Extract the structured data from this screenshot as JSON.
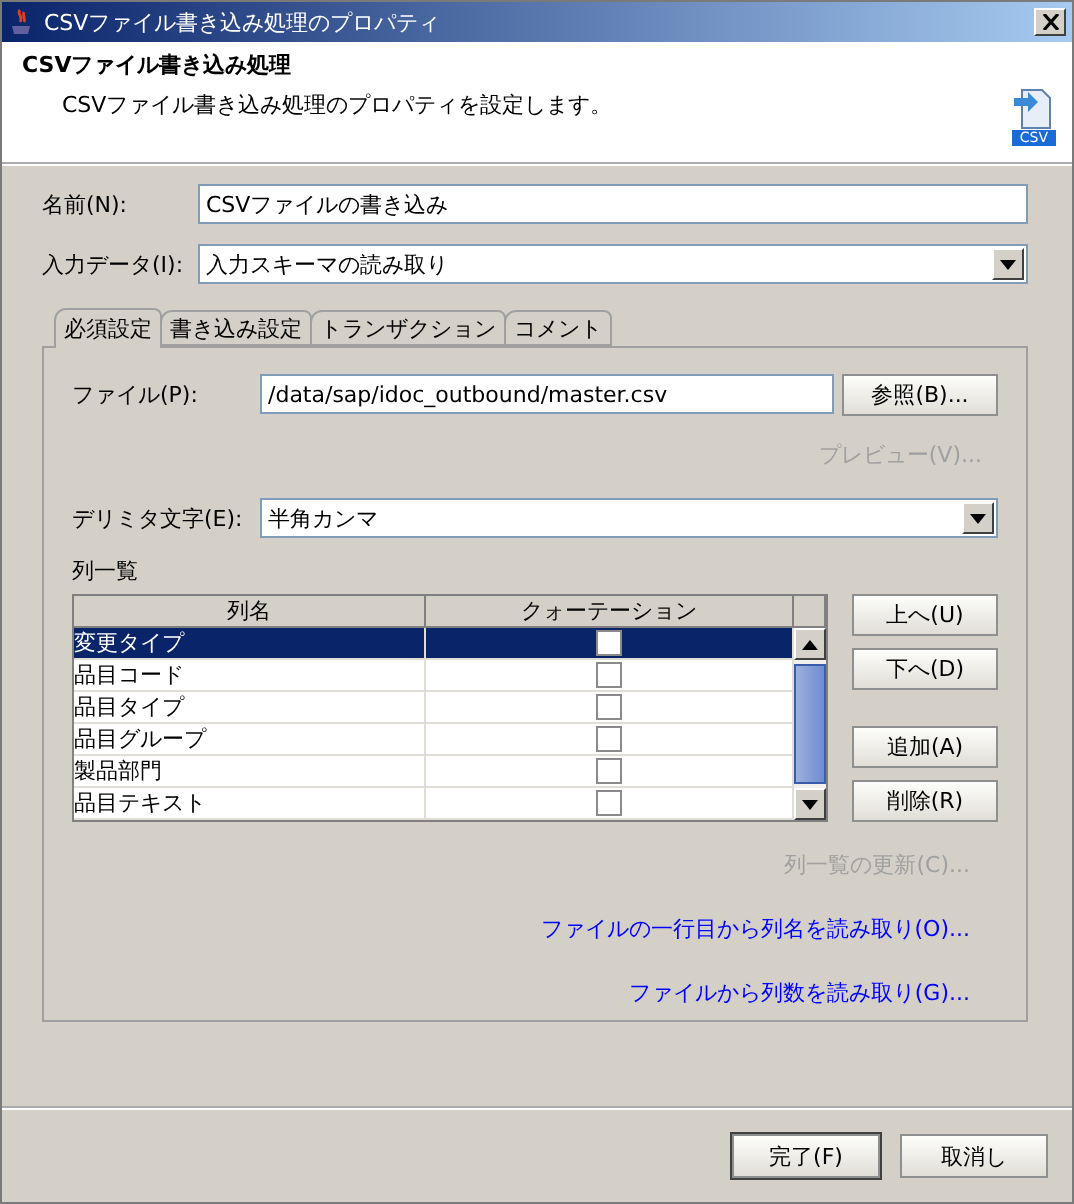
{
  "window": {
    "title": "CSVファイル書き込み処理のプロパティ"
  },
  "header": {
    "title": "CSVファイル書き込み処理",
    "description": "CSVファイル書き込み処理のプロパティを設定します。",
    "icon_label": "CSV"
  },
  "name_field": {
    "label": "名前(N):",
    "value": "CSVファイルの書き込み"
  },
  "input_data": {
    "label": "入力データ(I):",
    "value": "入力スキーマの読み取り"
  },
  "tabs": [
    {
      "label": "必須設定",
      "selected": true
    },
    {
      "label": "書き込み設定",
      "selected": false
    },
    {
      "label": "トランザクション",
      "selected": false
    },
    {
      "label": "コメント",
      "selected": false
    }
  ],
  "file_field": {
    "label": "ファイル(P):",
    "value": "/data/sap/idoc_outbound/master.csv",
    "browse_button": "参照(B)..."
  },
  "preview_button": {
    "label": "プレビュー(V)...",
    "disabled": true
  },
  "delimiter": {
    "label": "デリミタ文字(E):",
    "value": "半角カンマ"
  },
  "column_list": {
    "title": "列一覧",
    "columns": [
      "列名",
      "クォーテーション"
    ],
    "rows": [
      {
        "name": "変更タイプ",
        "quoted": false,
        "selected": true
      },
      {
        "name": "品目コード",
        "quoted": false,
        "selected": false
      },
      {
        "name": "品目タイプ",
        "quoted": false,
        "selected": false
      },
      {
        "name": "品目グループ",
        "quoted": false,
        "selected": false
      },
      {
        "name": "製品部門",
        "quoted": false,
        "selected": false
      },
      {
        "name": "品目テキスト",
        "quoted": false,
        "selected": false
      }
    ],
    "side_buttons": [
      "上へ(U)",
      "下へ(D)",
      "追加(A)",
      "削除(R)"
    ]
  },
  "actions": [
    {
      "label": "列一覧の更新(C)...",
      "disabled": true
    },
    {
      "label": "ファイルの一行目から列名を読み取り(O)...",
      "disabled": false
    },
    {
      "label": "ファイルから列数を読み取り(G)...",
      "disabled": false
    }
  ],
  "footer_buttons": [
    {
      "label": "完了(F)",
      "default": true
    },
    {
      "label": "取消し",
      "default": false
    }
  ]
}
